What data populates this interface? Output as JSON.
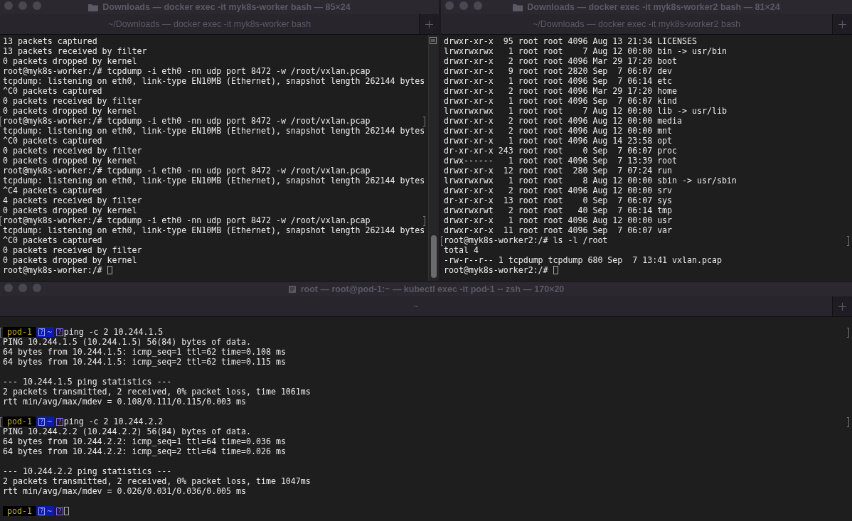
{
  "top_windows": [
    {
      "title": "Downloads — docker exec -it myk8s-worker bash — 85×24",
      "tab": "~/Downloads — docker exec -it myk8s-worker bash",
      "scrollbar": true,
      "cursor": true,
      "lines": [
        {
          "text": "13 packets captured",
          "marked": false
        },
        {
          "text": "13 packets received by filter",
          "marked": false
        },
        {
          "text": "0 packets dropped by kernel",
          "marked": false
        },
        {
          "text": "root@myk8s-worker:/# tcpdump -i eth0 -nn udp port 8472 -w /root/vxlan.pcap",
          "marked": false
        },
        {
          "text": "tcpdump: listening on eth0, link-type EN10MB (Ethernet), snapshot length 262144 bytes",
          "marked": false
        },
        {
          "text": "^C0 packets captured",
          "marked": false
        },
        {
          "text": "0 packets received by filter",
          "marked": false
        },
        {
          "text": "0 packets dropped by kernel",
          "marked": false
        },
        {
          "text": "root@myk8s-worker:/# tcpdump -i eth0 -nn udp port 8472 -w /root/vxlan.pcap",
          "marked": true
        },
        {
          "text": "tcpdump: listening on eth0, link-type EN10MB (Ethernet), snapshot length 262144 bytes",
          "marked": false
        },
        {
          "text": "^C0 packets captured",
          "marked": false
        },
        {
          "text": "0 packets received by filter",
          "marked": false
        },
        {
          "text": "0 packets dropped by kernel",
          "marked": false
        },
        {
          "text": "root@myk8s-worker:/# tcpdump -i eth0 -nn udp port 8472 -w /root/vxlan.pcap",
          "marked": false
        },
        {
          "text": "tcpdump: listening on eth0, link-type EN10MB (Ethernet), snapshot length 262144 bytes",
          "marked": false
        },
        {
          "text": "^C4 packets captured",
          "marked": false
        },
        {
          "text": "4 packets received by filter",
          "marked": false
        },
        {
          "text": "0 packets dropped by kernel",
          "marked": false
        },
        {
          "text": "root@myk8s-worker:/# tcpdump -i eth0 -nn udp port 8472 -w /root/vxlan.pcap",
          "marked": true
        },
        {
          "text": "tcpdump: listening on eth0, link-type EN10MB (Ethernet), snapshot length 262144 bytes",
          "marked": false
        },
        {
          "text": "^C0 packets captured",
          "marked": false
        },
        {
          "text": "0 packets received by filter",
          "marked": false
        },
        {
          "text": "0 packets dropped by kernel",
          "marked": false
        },
        {
          "text": "root@myk8s-worker:/# ",
          "marked": false
        }
      ]
    },
    {
      "title": "Downloads — docker exec -it myk8s-worker2 bash — 81×24",
      "tab": "~/Downloads — docker exec -it myk8s-worker2 bash",
      "cursor": true,
      "lines": [
        {
          "text": "drwxr-xr-x  95 root root 4096 Aug 13 21:34 LICENSES",
          "marked": false
        },
        {
          "text": "lrwxrwxrwx   1 root root    7 Aug 12 00:00 bin -> usr/bin",
          "marked": false
        },
        {
          "text": "drwxr-xr-x   2 root root 4096 Mar 29 17:20 boot",
          "marked": false
        },
        {
          "text": "drwxr-xr-x   9 root root 2820 Sep  7 06:07 dev",
          "marked": false
        },
        {
          "text": "drwxr-xr-x   1 root root 4096 Sep  7 06:14 etc",
          "marked": false
        },
        {
          "text": "drwxr-xr-x   2 root root 4096 Mar 29 17:20 home",
          "marked": false
        },
        {
          "text": "drwxr-xr-x   1 root root 4096 Sep  7 06:07 kind",
          "marked": false
        },
        {
          "text": "lrwxrwxrwx   1 root root    7 Aug 12 00:00 lib -> usr/lib",
          "marked": false
        },
        {
          "text": "drwxr-xr-x   2 root root 4096 Aug 12 00:00 media",
          "marked": false
        },
        {
          "text": "drwxr-xr-x   2 root root 4096 Aug 12 00:00 mnt",
          "marked": false
        },
        {
          "text": "drwxr-xr-x   1 root root 4096 Aug 14 23:58 opt",
          "marked": false
        },
        {
          "text": "dr-xr-xr-x 243 root root    0 Sep  7 06:07 proc",
          "marked": false
        },
        {
          "text": "drwx------   1 root root 4096 Sep  7 13:39 root",
          "marked": false
        },
        {
          "text": "drwxr-xr-x  12 root root  280 Sep  7 07:24 run",
          "marked": false
        },
        {
          "text": "lrwxrwxrwx   1 root root    8 Aug 12 00:00 sbin -> usr/sbin",
          "marked": false
        },
        {
          "text": "drwxr-xr-x   2 root root 4096 Aug 12 00:00 srv",
          "marked": false
        },
        {
          "text": "dr-xr-xr-x  13 root root    0 Sep  7 06:07 sys",
          "marked": false
        },
        {
          "text": "drwxrwxrwt   2 root root   40 Sep  7 06:14 tmp",
          "marked": false
        },
        {
          "text": "drwxr-xr-x   1 root root 4096 Aug 12 00:00 usr",
          "marked": false
        },
        {
          "text": "drwxr-xr-x  11 root root 4096 Sep  7 06:07 var",
          "marked": false
        },
        {
          "text": "root@myk8s-worker2:/# ls -l /root",
          "marked": true
        },
        {
          "text": "total 4",
          "marked": false
        },
        {
          "text": "-rw-r--r-- 1 tcpdump tcpdump 680 Sep  7 13:41 vxlan.pcap",
          "marked": false
        },
        {
          "text": "root@myk8s-worker2:/# ",
          "marked": false
        }
      ]
    }
  ],
  "bottom_window": {
    "title": "root — root@pod-1:~ — kubectl exec -it pod-1 -- zsh — 170×20",
    "tab": "~",
    "cursor": true,
    "lines": [
      {
        "kind": "prompt",
        "host": "pod-1",
        "dir_glyph": "?",
        "dir": "~",
        "prompt_glyph": "?",
        "command": "ping -c 2 10.244.1.5",
        "marked": true
      },
      {
        "kind": "output",
        "text": "PING 10.244.1.5 (10.244.1.5) 56(84) bytes of data.",
        "marked": false
      },
      {
        "kind": "output",
        "text": "64 bytes from 10.244.1.5: icmp_seq=1 ttl=62 time=0.108 ms",
        "marked": false
      },
      {
        "kind": "output",
        "text": "64 bytes from 10.244.1.5: icmp_seq=2 ttl=62 time=0.115 ms",
        "marked": false
      },
      {
        "kind": "blank"
      },
      {
        "kind": "output",
        "text": "--- 10.244.1.5 ping statistics ---",
        "marked": false
      },
      {
        "kind": "output",
        "text": "2 packets transmitted, 2 received, 0% packet loss, time 1061ms",
        "marked": false
      },
      {
        "kind": "output",
        "text": "rtt min/avg/max/mdev = 0.108/0.111/0.115/0.003 ms",
        "marked": false
      },
      {
        "kind": "blank"
      },
      {
        "kind": "prompt",
        "host": "pod-1",
        "dir_glyph": "?",
        "dir": "~",
        "prompt_glyph": "?",
        "command": "ping -c 2 10.244.2.2",
        "marked": true
      },
      {
        "kind": "output",
        "text": "PING 10.244.2.2 (10.244.2.2) 56(84) bytes of data.",
        "marked": false
      },
      {
        "kind": "output",
        "text": "64 bytes from 10.244.2.2: icmp_seq=1 ttl=64 time=0.036 ms",
        "marked": false
      },
      {
        "kind": "output",
        "text": "64 bytes from 10.244.2.2: icmp_seq=2 ttl=64 time=0.026 ms",
        "marked": false
      },
      {
        "kind": "blank"
      },
      {
        "kind": "output",
        "text": "--- 10.244.2.2 ping statistics ---",
        "marked": false
      },
      {
        "kind": "output",
        "text": "2 packets transmitted, 2 received, 0% packet loss, time 1047ms",
        "marked": false
      },
      {
        "kind": "output",
        "text": "rtt min/avg/max/mdev = 0.026/0.031/0.036/0.005 ms",
        "marked": false
      },
      {
        "kind": "blank"
      },
      {
        "kind": "prompt",
        "host": "pod-1",
        "dir_glyph": "?",
        "dir": "~",
        "prompt_glyph": "?",
        "marked": false
      }
    ]
  }
}
